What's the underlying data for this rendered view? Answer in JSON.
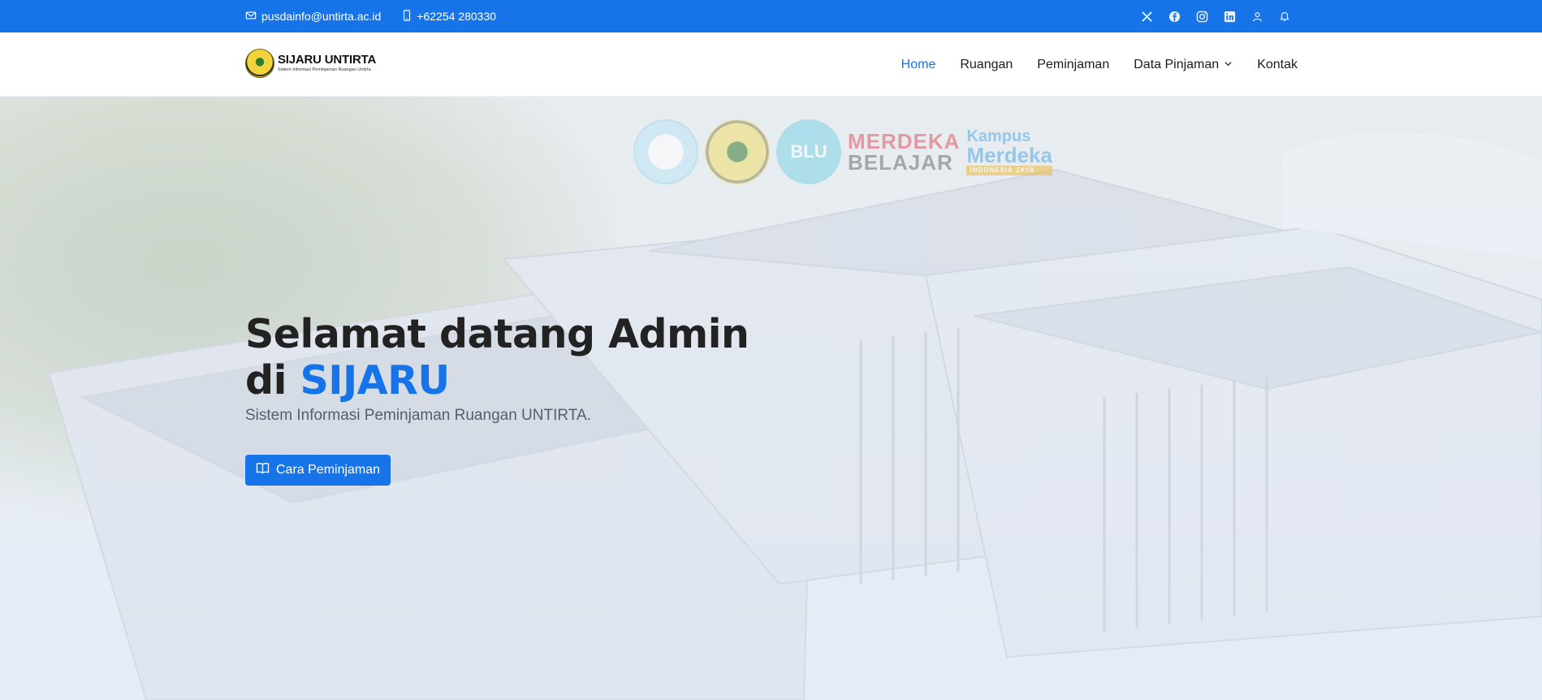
{
  "topbar": {
    "email": "pusdainfo@untirta.ac.id",
    "phone": "+62254 280330",
    "social_icons": [
      "x-icon",
      "facebook-icon",
      "instagram-icon",
      "linkedin-icon",
      "user-icon",
      "bell-icon"
    ]
  },
  "header": {
    "logo_name": "SIJARU UNTIRTA",
    "logo_tagline": "Sistem Informasi Peminjaman Ruangan Untirta",
    "nav": [
      {
        "label": "Home",
        "active": true
      },
      {
        "label": "Ruangan"
      },
      {
        "label": "Peminjaman"
      },
      {
        "label": "Data Pinjaman",
        "dropdown": true
      },
      {
        "label": "Kontak"
      }
    ]
  },
  "hero": {
    "partners": {
      "blu": "BLU",
      "merdeka_line1": "MERDEKA",
      "merdeka_line2": "BELAJAR",
      "kampus_line1": "Kampus",
      "kampus_line2": "Merdeka",
      "kampus_line3": "INDONESIA JAYA"
    },
    "title_line1": "Selamat datang Admin",
    "title_prefix": "di",
    "title_accent": "SIJARU",
    "subtitle": "Sistem Informasi Peminjaman Ruangan UNTIRTA.",
    "cta_label": "Cara Peminjaman"
  },
  "colors": {
    "brand": "#1674e8",
    "text_dark": "#222222",
    "subtitle": "#555f6b"
  }
}
